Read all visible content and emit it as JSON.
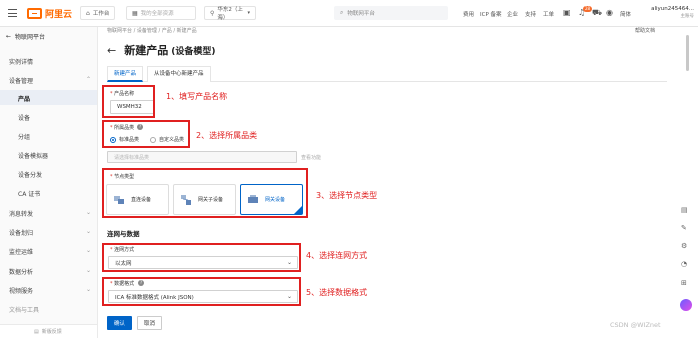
{
  "topbar": {
    "logo_text": "阿里云",
    "workspace": "工作台",
    "enterprise": "我的全部资源",
    "region": "华东2（上海）",
    "search_placeholder": "物联网平台",
    "links": [
      "费用",
      "ICP 备案",
      "企业",
      "支持",
      "工单"
    ],
    "notif_count": "28",
    "lang": "简体",
    "user_name": "aliyun245464...",
    "user_sub": "主账号"
  },
  "sidebar": {
    "header": "物联网平台",
    "items": [
      {
        "label": "实例详情",
        "level": 1
      },
      {
        "label": "设备管理",
        "level": 1
      },
      {
        "label": "产品",
        "level": 2,
        "active": true
      },
      {
        "label": "设备",
        "level": 2
      },
      {
        "label": "分组",
        "level": 2
      },
      {
        "label": "设备模拟器",
        "level": 2
      },
      {
        "label": "设备分发",
        "level": 2
      },
      {
        "label": "CA 证书",
        "level": 2
      },
      {
        "label": "消息转发",
        "level": 1
      },
      {
        "label": "设备划归",
        "level": 1
      },
      {
        "label": "监控运维",
        "level": 1
      },
      {
        "label": "数据分析",
        "level": 1
      },
      {
        "label": "视频服务",
        "level": 1
      },
      {
        "label": "文档与工具",
        "level": 1
      }
    ],
    "footer": "新版反馈"
  },
  "main": {
    "breadcrumb": "物联网平台  /  设备管理  /  产品  /  新建产品",
    "help_doc": "帮助文档",
    "title": "新建产品",
    "title_sub": "(设备模型)",
    "tabs": [
      "新建产品",
      "从设备中心新建产品"
    ],
    "product_name_label": "产品名称",
    "product_name_value": "WSMH32",
    "category_label": "所属品类",
    "category_options": [
      "标准品类",
      "自定义品类"
    ],
    "category_select_placeholder": "请选择标准品类",
    "category_view_link": "查看功能",
    "node_type_label": "节点类型",
    "node_types": [
      "直连设备",
      "网关子设备",
      "网关设备"
    ],
    "network_section": "连网与数据",
    "network_label": "连网方式",
    "network_value": "以太网",
    "data_format_label": "数据格式",
    "data_format_value": "ICA 标准数据格式 (Alink JSON)",
    "confirm": "确认",
    "cancel": "取消"
  },
  "annotations": [
    "1、填写产品名称",
    "2、选择所属品类",
    "3、选择节点类型",
    "4、选择连网方式",
    "5、选择数据格式"
  ],
  "watermark": "CSDN @WIZnet",
  "colors": {
    "primary": "#0064c8",
    "brand": "#ff6a00",
    "annotation": "#e02020"
  }
}
